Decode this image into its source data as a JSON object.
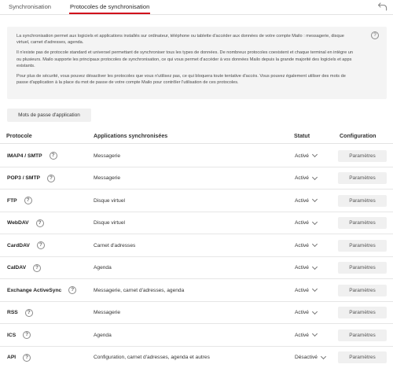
{
  "tabs": [
    {
      "label": "Synchronisation"
    },
    {
      "label": "Protocoles de synchronisation"
    }
  ],
  "info": {
    "paragraphs": [
      "La synchronisation permet aux logiciels et applications installés sur ordinateur, téléphone ou tablette d'accéder aux données de votre compte Mailo : messagerie, disque virtuel, carnet d'adresses, agenda.",
      "Il n'existe pas de protocole standard et universel permettant de synchroniser tous les types de données. De nombreux protocoles coexistent et chaque terminal en intègre un ou plusieurs. Mailo supporte les principaux protocoles de synchronisation, ce qui vous permet d'accéder à vos données Mailo depuis la grande majorité des logiciels et apps existants.",
      "Pour plus de sécurité, vous pouvez désactiver les protocoles que vous n'utilisez pas, ce qui bloquera toute tentative d'accès. Vous pouvez également utiliser des mots de passe d'application à la place du mot de passe de votre compte Mailo pour contrôler l'utilisation de ces protocoles."
    ]
  },
  "app_passwords_button": "Mots de passe d'application",
  "help_glyph": "?",
  "table": {
    "headers": [
      "Protocole",
      "Applications synchronisées",
      "Statut",
      "Configuration"
    ],
    "rows": [
      {
        "protocol": "IMAP4 / SMTP",
        "apps": "Messagerie",
        "status": "Activé",
        "config": "Paramètres"
      },
      {
        "protocol": "POP3 / SMTP",
        "apps": "Messagerie",
        "status": "Activé",
        "config": "Paramètres"
      },
      {
        "protocol": "FTP",
        "apps": "Disque virtuel",
        "status": "Activé",
        "config": "Paramètres"
      },
      {
        "protocol": "WebDAV",
        "apps": "Disque virtuel",
        "status": "Activé",
        "config": "Paramètres"
      },
      {
        "protocol": "CardDAV",
        "apps": "Carnet d'adresses",
        "status": "Activé",
        "config": "Paramètres"
      },
      {
        "protocol": "CalDAV",
        "apps": "Agenda",
        "status": "Activé",
        "config": "Paramètres"
      },
      {
        "protocol": "Exchange ActiveSync",
        "apps": "Messagerie, carnet d'adresses, agenda",
        "status": "Activé",
        "config": "Paramètres"
      },
      {
        "protocol": "RSS",
        "apps": "Messagerie",
        "status": "Activé",
        "config": "Paramètres"
      },
      {
        "protocol": "ICS",
        "apps": "Agenda",
        "status": "Activé",
        "config": "Paramètres"
      },
      {
        "protocol": "API",
        "apps": "Configuration, carnet d'adresses, agenda et autres",
        "status": "Désactivé",
        "config": "Paramètres"
      }
    ]
  },
  "colors": {
    "accent": "#d0021b",
    "panel": "#f4f4f4",
    "button": "#f0f0f0"
  },
  "icons": {
    "back": "undo-arrow-icon",
    "help": "question-circle-icon",
    "status": "chevron-down-icon"
  }
}
